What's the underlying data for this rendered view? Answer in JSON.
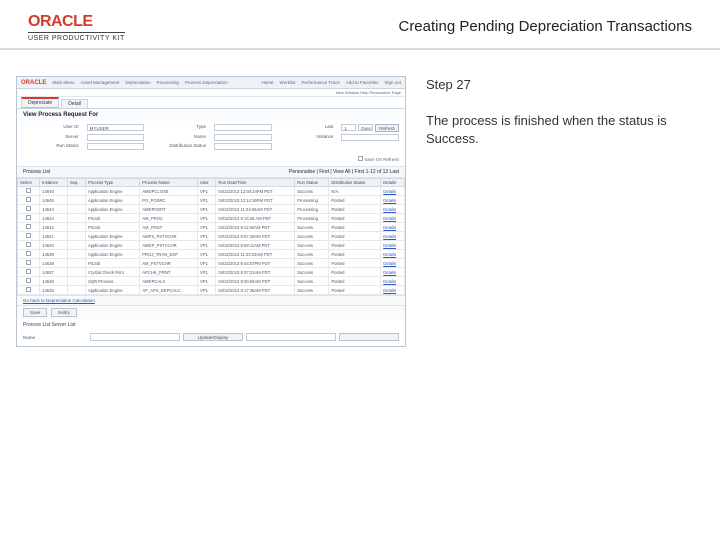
{
  "header": {
    "logo_text": "ORACLE",
    "logo_sub": "USER PRODUCTIVITY KIT",
    "page_title": "Creating Pending Depreciation Transactions"
  },
  "right_panel": {
    "step": "Step 27",
    "body": "The process is finished when the status is Success."
  },
  "app": {
    "topbar": [
      "ORACLE",
      "Main Menu",
      "Asset Management",
      "Depreciation",
      "Processing",
      "Process Depreciation",
      "Home",
      "Worklist",
      "Performance Trace",
      "Add to Favorites",
      "Sign out"
    ],
    "crumb": "New Window   Help   Personalize Page",
    "tabs": {
      "a": "Depreciate",
      "b": "Detail"
    },
    "section_title": "View Process Request For",
    "form": {
      "userid_lbl": "User ID",
      "userid": "MYUSER",
      "type_lbl": "Type",
      "type": "",
      "last_lbl": "Last",
      "last": "1",
      "units_lbl": "",
      "units": "Days",
      "refresh": "Refresh",
      "server_lbl": "Server",
      "server": "",
      "name_lbl": "Name",
      "name": "",
      "instance_lbl": "Instance",
      "instance": "",
      "run_lbl": "Run Status",
      "run": "",
      "dist_lbl": "Distribution Status",
      "dist": "",
      "save": "Save On Refresh"
    },
    "proc_title_left": "Process List",
    "proc_title_right": "Personalize | Find | View All |   First   1-12 of 12   Last",
    "cols": [
      "Select",
      "Instance",
      "Seq.",
      "Process Type",
      "Process Name",
      "User",
      "Run Date/Time",
      "Run Status",
      "Distribution Status",
      "Details"
    ],
    "rows": [
      {
        "instance": "14646",
        "seq": "",
        "ptype": "Application Engine",
        "pname": "AMDPCLOSE",
        "user": "VP1",
        "rundt": "04/22/2013 12:50:24PM PDT",
        "rstat": "Success",
        "dstat": "N/A",
        "det": "Details"
      },
      {
        "instance": "14645",
        "seq": "",
        "ptype": "Application Engine",
        "pname": "PO_POSRC",
        "user": "VP1",
        "rundt": "04/22/2013 12:14:36PM PDT",
        "rstat": "Processing",
        "dstat": "Posted",
        "det": "Details"
      },
      {
        "instance": "14644",
        "seq": "",
        "ptype": "Application Engine",
        "pname": "AMDPCERT",
        "user": "VP1",
        "rundt": "04/22/2013 11:34:06AM PDT",
        "rstat": "Processing",
        "dstat": "Posted",
        "det": "Details"
      },
      {
        "instance": "14643",
        "seq": "",
        "ptype": "PSJob",
        "pname": "AM_PROC",
        "user": "VP1",
        "rundt": "04/22/2013 9:14:26 AM PDT",
        "rstat": "Processing",
        "dstat": "Posted",
        "det": "Details"
      },
      {
        "instance": "14642",
        "seq": "",
        "ptype": "PSJob",
        "pname": "AM_POST",
        "user": "VP1",
        "rundt": "04/22/2013 9:11:50AM PDT",
        "rstat": "Success",
        "dstat": "Posted",
        "det": "Details"
      },
      {
        "instance": "14641",
        "seq": "",
        "ptype": "Application Engine",
        "pname": "AMPS_PSTVCHR",
        "user": "VP1",
        "rundt": "04/22/2013 9:07:29AM PDT",
        "rstat": "Success",
        "dstat": "Posted",
        "det": "Details"
      },
      {
        "instance": "14640",
        "seq": "",
        "ptype": "Application Engine",
        "pname": "AMDP_PSTVCHR",
        "user": "VP1",
        "rundt": "04/22/2013 8:59:11AM PDT",
        "rstat": "Success",
        "dstat": "Posted",
        "det": "Details"
      },
      {
        "instance": "14639",
        "seq": "",
        "ptype": "Application Engine",
        "pname": "PROJ_TRAN_EXP",
        "user": "VP1",
        "rundt": "04/22/2013 11:30:23AM PDT",
        "rstat": "Success",
        "dstat": "Posted",
        "det": "Details"
      },
      {
        "instance": "14638",
        "seq": "",
        "ptype": "PSJob",
        "pname": "AM_PSTVCHR",
        "user": "VP1",
        "rundt": "04/22/2013 9:44:07PM PDT",
        "rstat": "Success",
        "dstat": "Posted",
        "det": "Details"
      },
      {
        "instance": "14637",
        "seq": "",
        "ptype": "Crystal Check Print",
        "pname": "APCHK_PRNT",
        "user": "VP1",
        "rundt": "04/22/2013 9:37:21AM PDT",
        "rstat": "Success",
        "dstat": "Posted",
        "det": "Details"
      },
      {
        "instance": "14636",
        "seq": "",
        "ptype": "SQR Process",
        "pname": "AMDPCALC",
        "user": "VP1",
        "rundt": "04/22/2013 9:30:55AM PDT",
        "rstat": "Success",
        "dstat": "Posted",
        "det": "Details"
      },
      {
        "instance": "14635",
        "seq": "",
        "ptype": "Application Engine",
        "pname": "AP_APX_DEPCALC",
        "user": "VP1",
        "rundt": "04/22/2013 9:17:35AM PDT",
        "rstat": "Success",
        "dstat": "Posted",
        "det": "Details"
      }
    ],
    "foot_back": "Go back to Depreciation Calculation",
    "save_btn": "Save",
    "notify_btn": "Notify",
    "sel_line": "Process List   Server List",
    "bottom": {
      "name_lbl": "Name",
      "update_btn": "Update/Display",
      "last_lbl": "",
      "last_btn": ""
    }
  }
}
